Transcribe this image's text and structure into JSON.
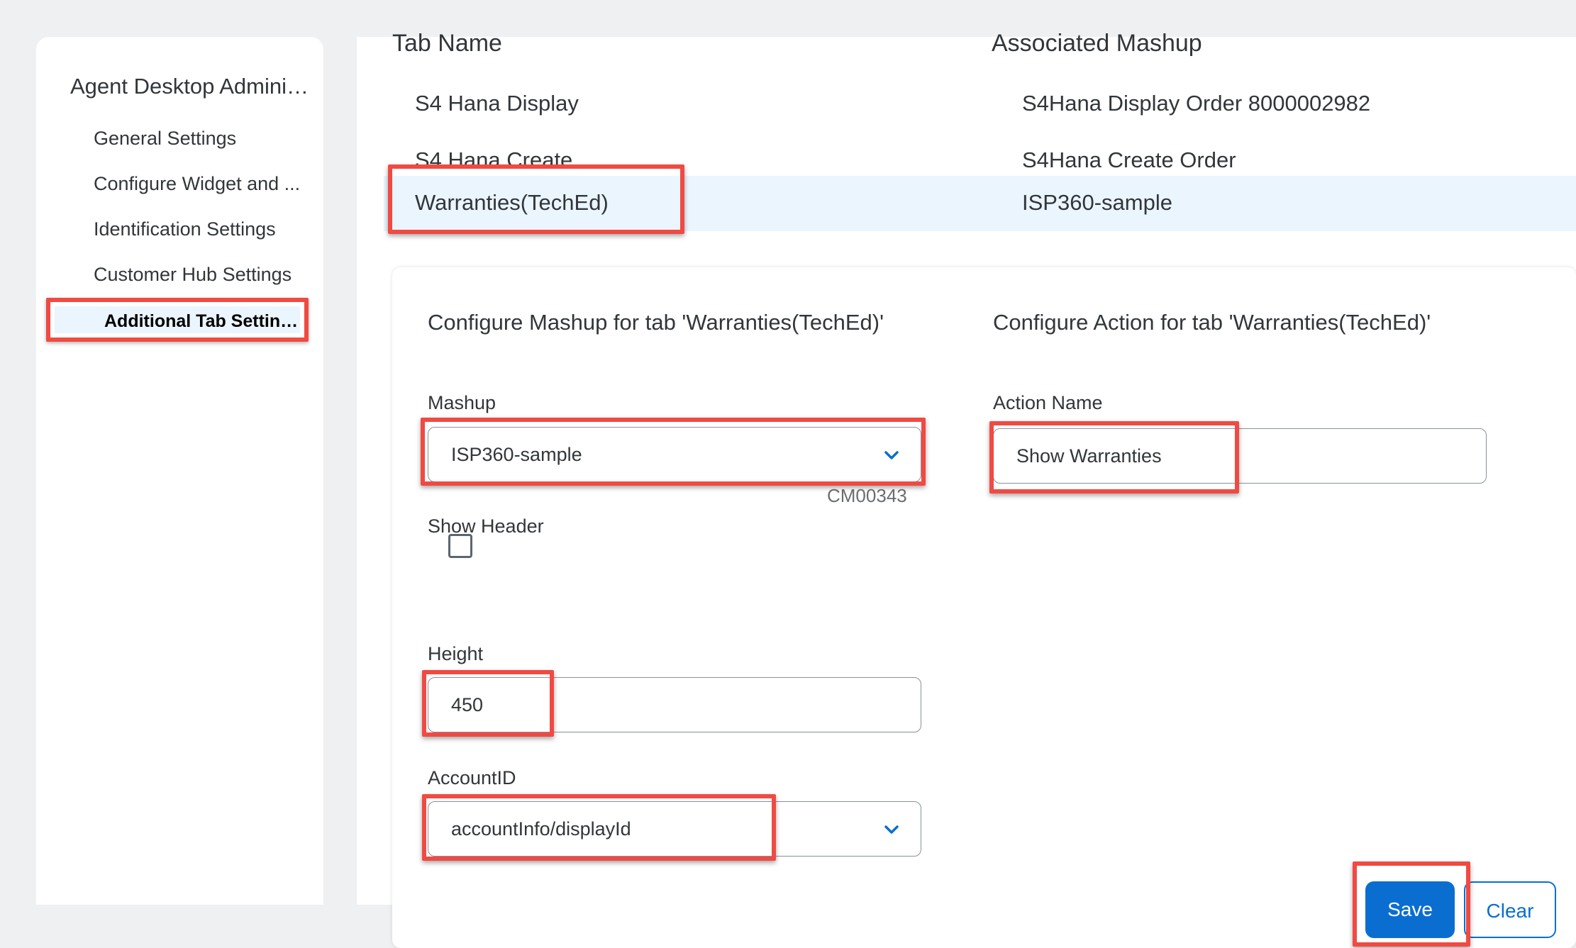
{
  "sidebar": {
    "title": "Agent Desktop Adminis...",
    "items": [
      {
        "label": "General Settings"
      },
      {
        "label": "Configure Widget and ..."
      },
      {
        "label": "Identification Settings"
      },
      {
        "label": "Customer Hub Settings"
      },
      {
        "label": "Additional Tab Settings ..."
      }
    ]
  },
  "table": {
    "headers": {
      "tab_name": "Tab Name",
      "associated_mashup": "Associated Mashup"
    },
    "rows": [
      {
        "tab_name": "S4 Hana Display",
        "mashup": "S4Hana Display Order 8000002982"
      },
      {
        "tab_name": "S4 Hana Create",
        "mashup": "S4Hana Create Order"
      },
      {
        "tab_name": "Warranties(TechEd)",
        "mashup": "ISP360-sample"
      }
    ]
  },
  "panel": {
    "mashup_heading": "Configure Mashup for tab 'Warranties(TechEd)'",
    "action_heading": "Configure Action for tab 'Warranties(TechEd)'",
    "mashup_label": "Mashup",
    "mashup_value": "ISP360-sample",
    "mashup_hint": "CM00343",
    "show_header_label": "Show Header",
    "height_label": "Height",
    "height_value": "450",
    "accountid_label": "AccountID",
    "accountid_value": "accountInfo/displayId",
    "action_name_label": "Action Name",
    "action_name_value": "Show Warranties",
    "save_label": "Save",
    "clear_label": "Clear"
  },
  "colors": {
    "accent": "#0a6ed1",
    "highlight": "#f04a42",
    "selected_row": "#ebf5fe"
  }
}
